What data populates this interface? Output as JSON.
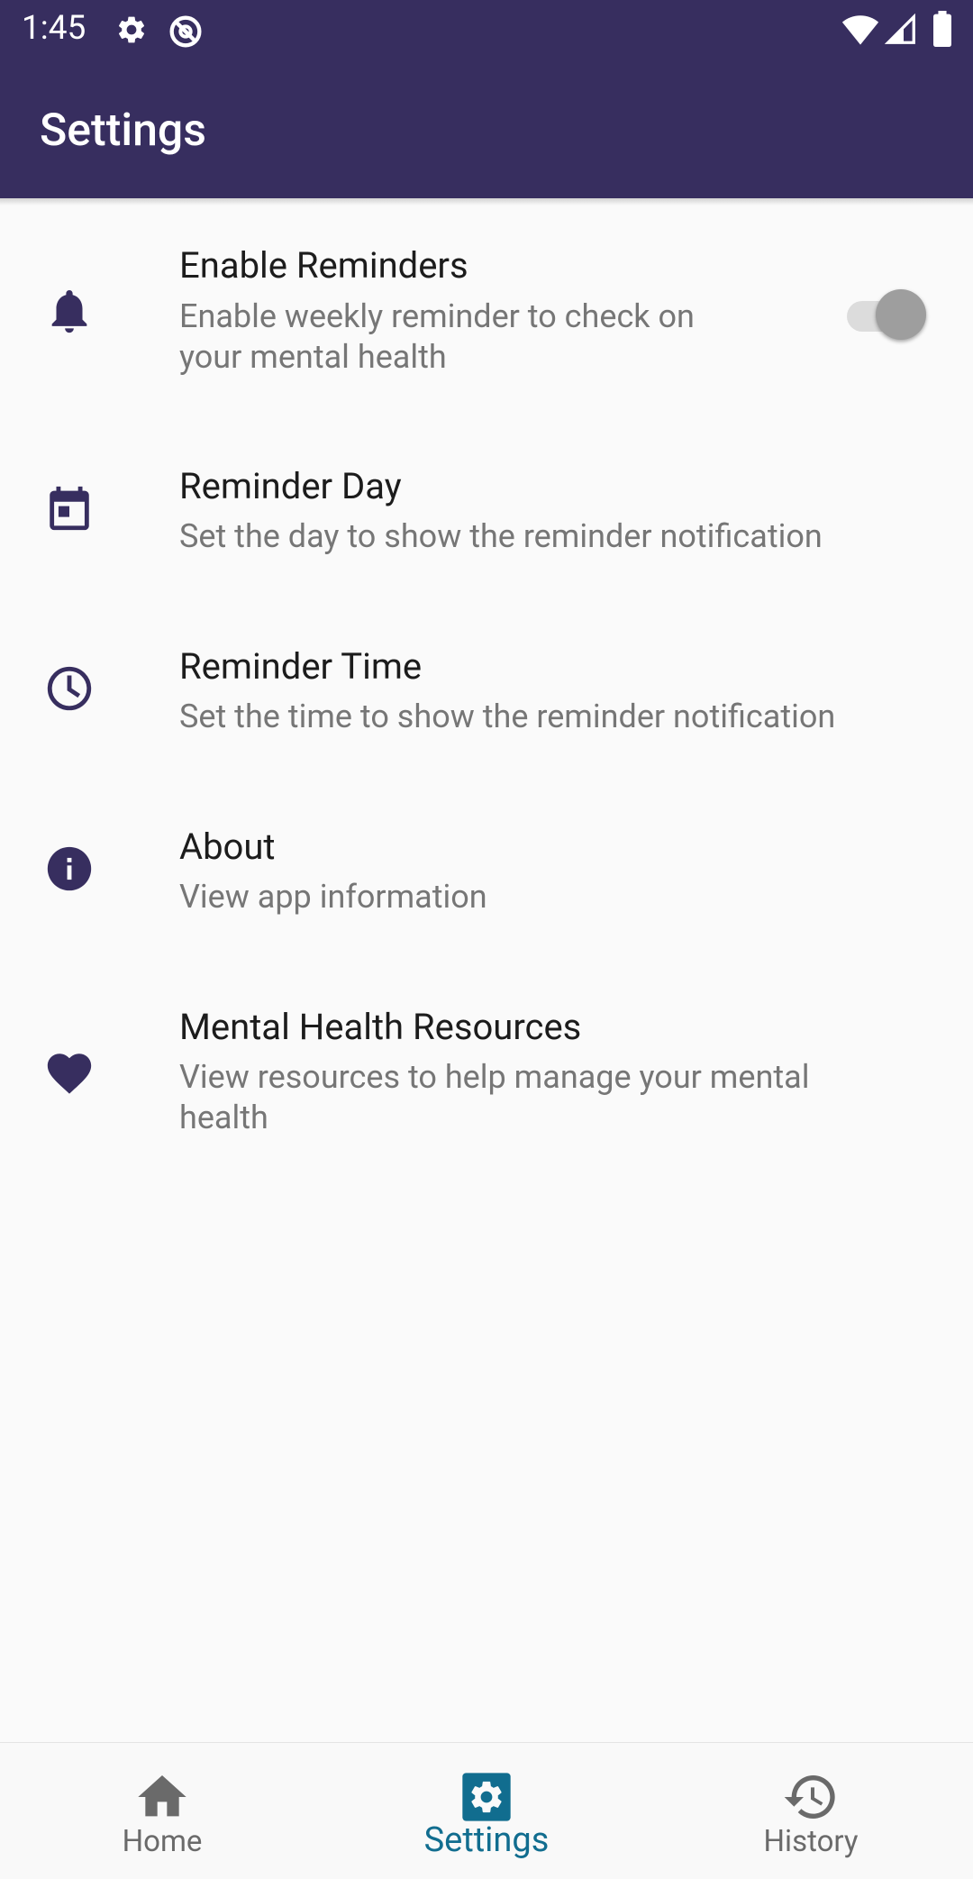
{
  "status_bar": {
    "time": "1:45",
    "icons": [
      "settings-gear-icon",
      "sync-disabled-icon",
      "wifi-icon",
      "signal-icon",
      "battery-icon"
    ]
  },
  "app_bar": {
    "title": "Settings"
  },
  "settings": [
    {
      "icon": "bell-icon",
      "title": "Enable Reminders",
      "summary": "Enable weekly reminder to check on\nyour mental health",
      "toggle": "off"
    },
    {
      "icon": "calendar-icon",
      "title": "Reminder Day",
      "summary": "Set the day to show the reminder notification"
    },
    {
      "icon": "clock-icon",
      "title": "Reminder Time",
      "summary": "Set the time to show the reminder notification"
    },
    {
      "icon": "info-icon",
      "title": "About",
      "summary": "View app information"
    },
    {
      "icon": "heart-icon",
      "title": "Mental Health Resources",
      "summary": "View resources to help manage your mental\nhealth"
    }
  ],
  "bottom_nav": {
    "tabs": [
      {
        "label": "Home",
        "icon": "home-icon",
        "active": false
      },
      {
        "label": "Settings",
        "icon": "settings-icon",
        "active": true
      },
      {
        "label": "History",
        "icon": "history-icon",
        "active": false
      }
    ]
  },
  "colors": {
    "primary": "#372e5f",
    "active_tab": "#116d8f",
    "inactive_tab": "#6a6a6a",
    "summary_text": "#767676",
    "background": "#fafafa"
  }
}
